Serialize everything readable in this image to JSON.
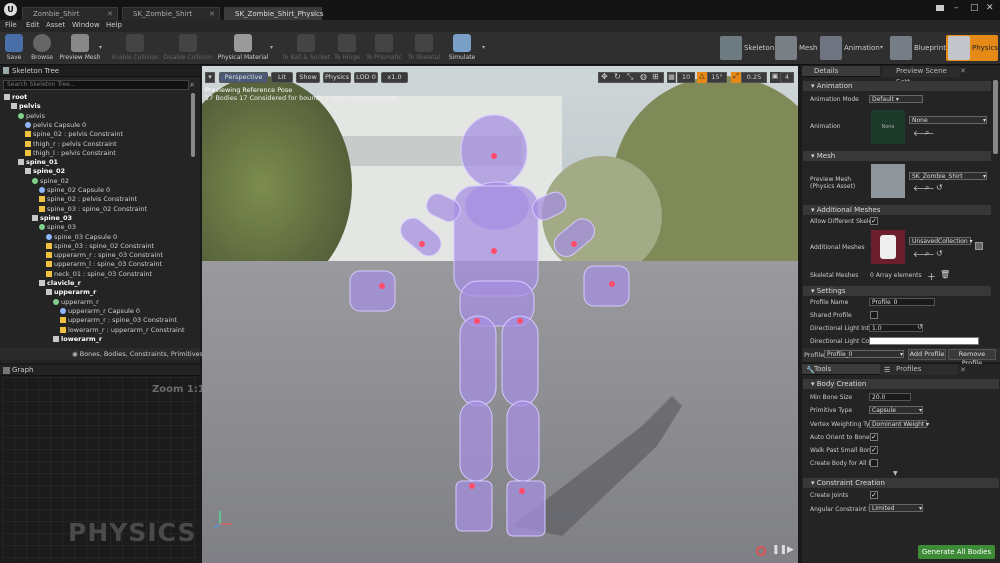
{
  "window": {
    "logo": "U",
    "tabs": [
      "Zombie_Shirt",
      "SK_Zombie_Shirt",
      "SK_Zombie_Shirt_Physics"
    ],
    "controls": [
      "–",
      "□",
      "✕"
    ]
  },
  "menu": [
    "File",
    "Edit",
    "Asset",
    "Window",
    "Help"
  ],
  "toolbar": {
    "buttons": [
      {
        "label": "Save",
        "enabled": true
      },
      {
        "label": "Browse",
        "enabled": true
      },
      {
        "label": "Preview Mesh",
        "enabled": true
      },
      {
        "label": "Enable Collision",
        "enabled": false
      },
      {
        "label": "Disable Collision",
        "enabled": false
      },
      {
        "label": "Physical Material",
        "enabled": true
      },
      {
        "label": "To Ball & Socket",
        "enabled": false
      },
      {
        "label": "To Hinge",
        "enabled": false
      },
      {
        "label": "To Prismatic",
        "enabled": false
      },
      {
        "label": "To Skeletal",
        "enabled": false
      },
      {
        "label": "Simulate",
        "enabled": true
      }
    ],
    "modes": [
      "Skeleton",
      "Mesh",
      "Animation",
      "Blueprint",
      "Physics"
    ]
  },
  "skeleton_tree": {
    "tab": "Skeleton Tree",
    "search_placeholder": "Search Skeleton Tree...",
    "rows": [
      {
        "text": "root",
        "bold": true,
        "indent": 0,
        "icon": "bone-icon"
      },
      {
        "text": "pelvis",
        "bold": true,
        "indent": 1,
        "icon": "bone-icon"
      },
      {
        "text": "pelvis",
        "bold": false,
        "indent": 2,
        "icon": "body-icon"
      },
      {
        "text": "pelvis Capsule 0",
        "bold": false,
        "indent": 3,
        "icon": "capsule-icon"
      },
      {
        "text": "spine_02 : pelvis Constraint",
        "bold": false,
        "indent": 3,
        "icon": "constraint-icon"
      },
      {
        "text": "thigh_r : pelvis Constraint",
        "bold": false,
        "indent": 3,
        "icon": "constraint-icon"
      },
      {
        "text": "thigh_l : pelvis Constraint",
        "bold": false,
        "indent": 3,
        "icon": "constraint-icon"
      },
      {
        "text": "spine_01",
        "bold": true,
        "indent": 2,
        "icon": "bone-icon"
      },
      {
        "text": "spine_02",
        "bold": true,
        "indent": 3,
        "icon": "bone-icon"
      },
      {
        "text": "spine_02",
        "bold": false,
        "indent": 4,
        "icon": "body-icon"
      },
      {
        "text": "spine_02 Capsule 0",
        "bold": false,
        "indent": 5,
        "icon": "capsule-icon"
      },
      {
        "text": "spine_02 : pelvis Constraint",
        "bold": false,
        "indent": 5,
        "icon": "constraint-icon"
      },
      {
        "text": "spine_03 : spine_02 Constraint",
        "bold": false,
        "indent": 5,
        "icon": "constraint-icon"
      },
      {
        "text": "spine_03",
        "bold": true,
        "indent": 4,
        "icon": "bone-icon"
      },
      {
        "text": "spine_03",
        "bold": false,
        "indent": 5,
        "icon": "body-icon"
      },
      {
        "text": "spine_03 Capsule 0",
        "bold": false,
        "indent": 6,
        "icon": "capsule-icon"
      },
      {
        "text": "spine_03 : spine_02 Constraint",
        "bold": false,
        "indent": 6,
        "icon": "constraint-icon"
      },
      {
        "text": "upperarm_r : spine_03 Constraint",
        "bold": false,
        "indent": 6,
        "icon": "constraint-icon"
      },
      {
        "text": "upperarm_l : spine_03 Constraint",
        "bold": false,
        "indent": 6,
        "icon": "constraint-icon"
      },
      {
        "text": "neck_01 : spine_03 Constraint",
        "bold": false,
        "indent": 6,
        "icon": "constraint-icon"
      },
      {
        "text": "clavicle_r",
        "bold": true,
        "indent": 5,
        "icon": "bone-icon"
      },
      {
        "text": "upperarm_r",
        "bold": true,
        "indent": 6,
        "icon": "bone-icon"
      },
      {
        "text": "upperarm_r",
        "bold": false,
        "indent": 7,
        "icon": "body-icon"
      },
      {
        "text": "upperarm_r Capsule 0",
        "bold": false,
        "indent": 8,
        "icon": "capsule-icon"
      },
      {
        "text": "upperarm_r : spine_03 Constraint",
        "bold": false,
        "indent": 8,
        "icon": "constraint-icon"
      },
      {
        "text": "lowerarm_r : upperarm_r Constraint",
        "bold": false,
        "indent": 8,
        "icon": "constraint-icon"
      },
      {
        "text": "lowerarm_r",
        "bold": true,
        "indent": 7,
        "icon": "bone-icon"
      }
    ],
    "filter": "Bones, Bodies, Constraints, Primitives"
  },
  "graph": {
    "tab": "Graph",
    "zoom": "Zoom 1:1",
    "watermark": "PHYSICS"
  },
  "viewport": {
    "buttons": [
      "Perspective",
      "Lit",
      "Show",
      "Physics",
      "LOD 0",
      "x1.0"
    ],
    "info_line1": "Previewing Reference Pose",
    "info_line2": "17 Bodies  17 Considered for bounds  1 Ratio  16 Constraints",
    "grid_value": "10",
    "rot_value": "15°",
    "scale_value": "0.25",
    "cam_value": "4"
  },
  "details": {
    "tabs": [
      "Details",
      "Preview Scene Sett"
    ],
    "animation": {
      "section": "Animation",
      "mode_label": "Animation Mode",
      "mode_value": "Default",
      "anim_label": "Animation",
      "anim_thumb": "None",
      "anim_value": "None"
    },
    "mesh": {
      "section": "Mesh",
      "preview_label_1": "Preview Mesh",
      "preview_label_2": "(Physics Asset)",
      "preview_value": "SK_Zombie_Shirt"
    },
    "additional": {
      "section": "Additional Meshes",
      "allow_label": "Allow Different Skele",
      "allow_checked": true,
      "meshes_label": "Additional Meshes",
      "meshes_value": "UnsavedCollection",
      "skeletal_label": "Skeletal Meshes",
      "skeletal_value": "0 Array elements"
    },
    "settings": {
      "section": "Settings",
      "profile_name_label": "Profile Name",
      "profile_name_value": "Profile_0",
      "shared_label": "Shared Profile",
      "dir_int_label": "Directional Light Inter",
      "dir_int_value": "1.0",
      "dir_col_label": "Directional Light Colo"
    },
    "profile_bar": {
      "label": "Profile",
      "value": "Profile_0",
      "add": "Add Profile",
      "remove": "Remove Profile"
    }
  },
  "tools": {
    "tabs": [
      "Tools",
      "Profiles"
    ],
    "body_creation": {
      "section": "Body Creation",
      "min_bone_label": "Min Bone Size",
      "min_bone_value": "20.0",
      "prim_label": "Primitive Type",
      "prim_value": "Capsule",
      "vw_label": "Vertex Weighting Type",
      "vw_value": "Dominant Weight",
      "orient_label": "Auto Orient to Bone",
      "orient_checked": true,
      "walk_label": "Walk Past Small Bone",
      "walk_checked": true,
      "create_all_label": "Create Body for All Bo",
      "create_all_checked": false
    },
    "constraint_creation": {
      "section": "Constraint Creation",
      "create_joints_label": "Create Joints",
      "create_joints_checked": true,
      "angular_label": "Angular Constraint Mo",
      "angular_value": "Limited"
    },
    "generate": "Generate All Bodies"
  },
  "colors": {
    "accent_orange": "#e58a16",
    "generate_green": "#3d8b37",
    "body_purple": "#a58fe0"
  }
}
